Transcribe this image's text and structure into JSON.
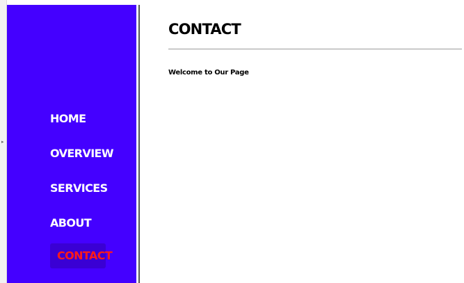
{
  "sidebar": {
    "items": [
      {
        "label": "HOME"
      },
      {
        "label": "OVERVIEW"
      },
      {
        "label": "SERVICES"
      },
      {
        "label": "ABOUT"
      },
      {
        "label": "CONTACT",
        "active": true
      }
    ],
    "background_color": "#4400ff",
    "active_text_color": "#ff1a1a"
  },
  "main": {
    "title": "CONTACT",
    "welcome_text": "Welcome to Our Page"
  },
  "edge_strip": {
    "icon": "chevron-right-icon"
  }
}
